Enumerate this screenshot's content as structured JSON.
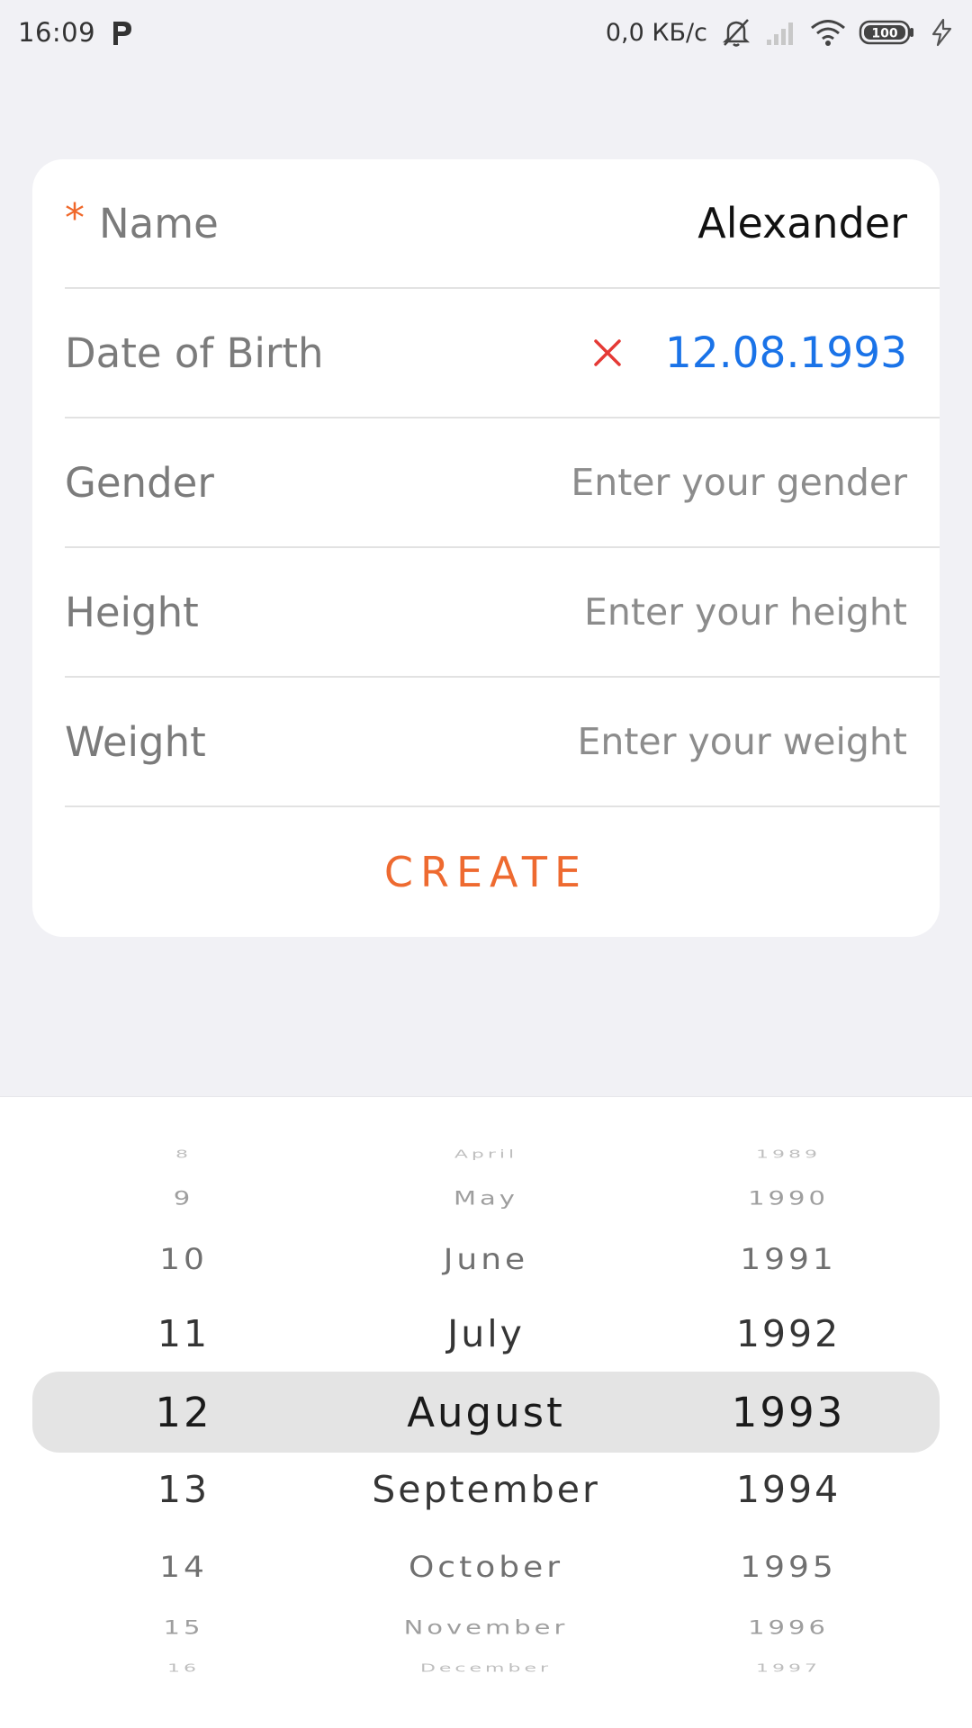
{
  "status_bar": {
    "time": "16:09",
    "app_icon": "parking-p-icon",
    "network_rate": "0,0 КБ/с",
    "icons": [
      "muted-bell-icon",
      "signal-icon",
      "wifi-icon",
      "battery-icon",
      "charging-icon"
    ],
    "battery_level": "100"
  },
  "form": {
    "required_mark": "*",
    "name": {
      "label": "Name",
      "value": "Alexander"
    },
    "dob": {
      "label": "Date of Birth",
      "value": "12.08.1993",
      "clear_icon": "close-icon"
    },
    "gender": {
      "label": "Gender",
      "placeholder": "Enter your gender"
    },
    "height": {
      "label": "Height",
      "placeholder": "Enter your height"
    },
    "weight": {
      "label": "Weight",
      "placeholder": "Enter your weight"
    },
    "create_label": "CREATE"
  },
  "picker": {
    "days": [
      "8",
      "9",
      "10",
      "11",
      "12",
      "13",
      "14",
      "15",
      "16"
    ],
    "months": [
      "April",
      "May",
      "June",
      "July",
      "August",
      "September",
      "October",
      "November",
      "December"
    ],
    "years": [
      "1989",
      "1990",
      "1991",
      "1992",
      "1993",
      "1994",
      "1995",
      "1996",
      "1997"
    ],
    "selected": {
      "day": "12",
      "month": "August",
      "year": "1993"
    }
  },
  "colors": {
    "background": "#f1f1f5",
    "accent_orange": "#ee6a30",
    "date_blue": "#1a73e8",
    "clear_red": "#e53935",
    "selection_gray": "#e4e4e4"
  }
}
